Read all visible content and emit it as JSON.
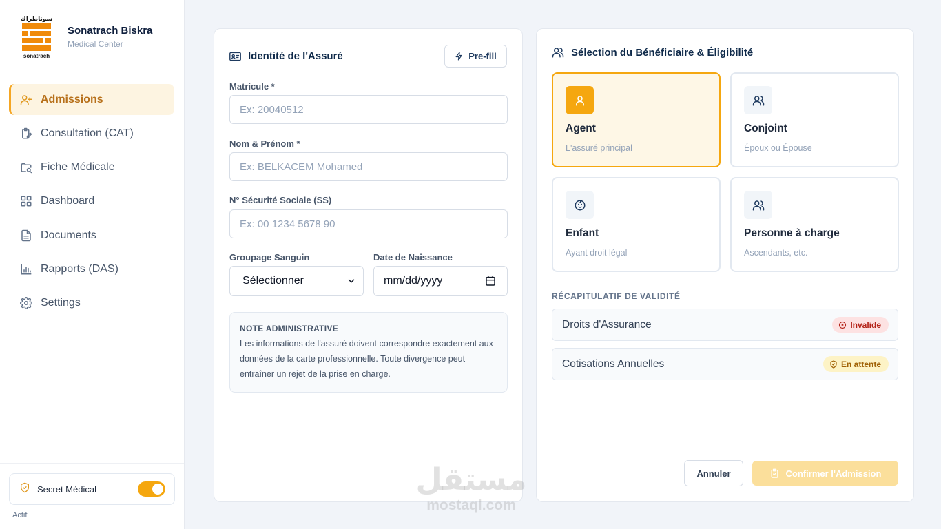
{
  "brand": {
    "logo_arabic": "سوناطراك",
    "logo_latin": "sonatrach",
    "name": "Sonatrach Biskra",
    "subtitle": "Medical Center"
  },
  "sidebar": {
    "items": [
      {
        "label": "Admissions",
        "icon": "user-plus-icon",
        "active": true
      },
      {
        "label": "Consultation (CAT)",
        "icon": "clipboard-edit-icon",
        "active": false
      },
      {
        "label": "Fiche Médicale",
        "icon": "folder-search-icon",
        "active": false
      },
      {
        "label": "Dashboard",
        "icon": "grid-icon",
        "active": false
      },
      {
        "label": "Documents",
        "icon": "file-text-icon",
        "active": false
      },
      {
        "label": "Rapports (DAS)",
        "icon": "bar-chart-icon",
        "active": false
      },
      {
        "label": "Settings",
        "icon": "gear-icon",
        "active": false
      }
    ],
    "footer": {
      "secret_label": "Secret Médical",
      "secret_enabled": true,
      "status": "Actif"
    }
  },
  "identity": {
    "title": "Identité de l'Assuré",
    "prefill_label": "Pre-fill",
    "matricule_label": "Matricule *",
    "matricule_placeholder": "Ex: 20040512",
    "nom_label": "Nom & Prénom *",
    "nom_placeholder": "Ex: BELKACEM Mohamed",
    "ss_label": "N° Sécurité Sociale (SS)",
    "ss_placeholder": "Ex: 00 1234 5678 90",
    "blood_label": "Groupage Sanguin",
    "blood_value": "Sélectionner",
    "dob_label": "Date de Naissance",
    "dob_value": "mm/dd/yyyy",
    "note_title": "NOTE ADMINISTRATIVE",
    "note_text": "Les informations de l'assuré doivent correspondre exactement aux données de la carte professionnelle. Toute divergence peut entraîner un rejet de la prise en charge."
  },
  "beneficiary": {
    "title": "Sélection du Bénéficiaire & Éligibilité",
    "options": [
      {
        "name": "Agent",
        "desc": "L'assuré principal",
        "icon": "user-icon",
        "selected": true
      },
      {
        "name": "Conjoint",
        "desc": "Époux ou Épouse",
        "icon": "users-icon",
        "selected": false
      },
      {
        "name": "Enfant",
        "desc": "Ayant droit légal",
        "icon": "baby-icon",
        "selected": false
      },
      {
        "name": "Personne à charge",
        "desc": "Ascendants, etc.",
        "icon": "users-icon",
        "selected": false
      }
    ],
    "recap_title": "RÉCAPITULATIF DE VALIDITÉ",
    "recap": [
      {
        "label": "Droits d'Assurance",
        "status": "Invalide",
        "status_color": "#b42318"
      },
      {
        "label": "Cotisations Annuelles",
        "status": "En attente",
        "status_color": "#a16207"
      }
    ],
    "cancel_label": "Annuler",
    "confirm_label": "Confirmer l'Admission"
  },
  "watermark": {
    "arabic": "مستقل",
    "latin": "mostaql.com"
  },
  "colors": {
    "accent": "#f5a70f",
    "accent_soft": "#fef7e6",
    "brand_orange": "#f08a0a",
    "navy": "#0f2a4a"
  }
}
